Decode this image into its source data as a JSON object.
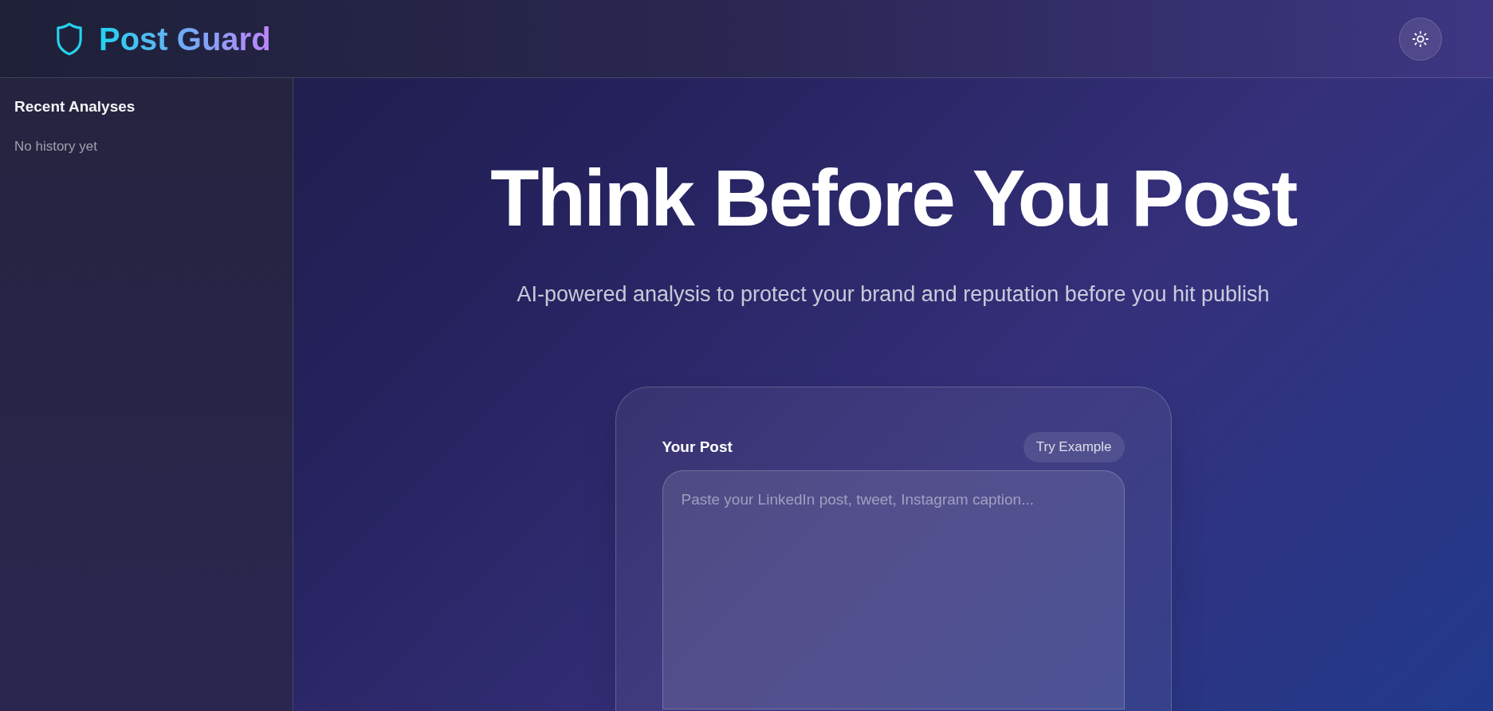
{
  "header": {
    "brand": "Post Guard"
  },
  "sidebar": {
    "title": "Recent Analyses",
    "empty_text": "No history yet"
  },
  "hero": {
    "title": "Think Before You Post",
    "subtitle": "AI-powered analysis to protect your brand and reputation before you hit publish"
  },
  "post_card": {
    "label": "Your Post",
    "example_button": "Try Example",
    "placeholder": "Paste your LinkedIn post, tweet, Instagram caption..."
  }
}
